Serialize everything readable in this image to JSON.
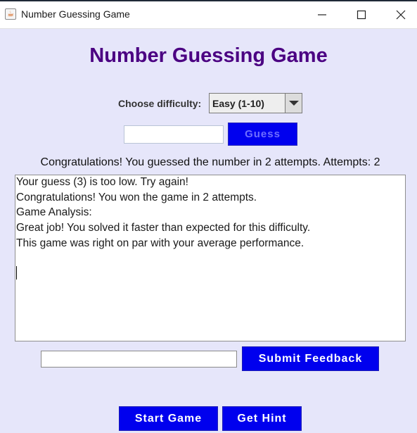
{
  "window": {
    "title": "Number Guessing Game",
    "app_icon": "java-cup-icon",
    "controls": [
      "minimize-icon",
      "maximize-icon",
      "close-icon"
    ]
  },
  "header": {
    "title": "Number Guessing Game",
    "title_color": "#4b0082"
  },
  "difficulty": {
    "label": "Choose difficulty:",
    "selected": "Easy (1-10)"
  },
  "guess": {
    "input_value": "",
    "button_label": "Guess"
  },
  "status": {
    "message": "Congratulations! You guessed the number in 2 attempts. Attempts: 2"
  },
  "log": {
    "lines": [
      "Your guess (3) is too low. Try again!",
      "Congratulations! You won the game in 2 attempts.",
      "Game Analysis:",
      "Great job! You solved it faster than expected for this difficulty.",
      "This game was right on par with your average performance."
    ]
  },
  "feedback": {
    "input_value": "",
    "submit_label": "Submit Feedback"
  },
  "footer": {
    "start_label": "Start Game",
    "hint_label": "Get Hint"
  },
  "colors": {
    "background": "#e6e6fa",
    "button_blue": "#0000ee"
  }
}
